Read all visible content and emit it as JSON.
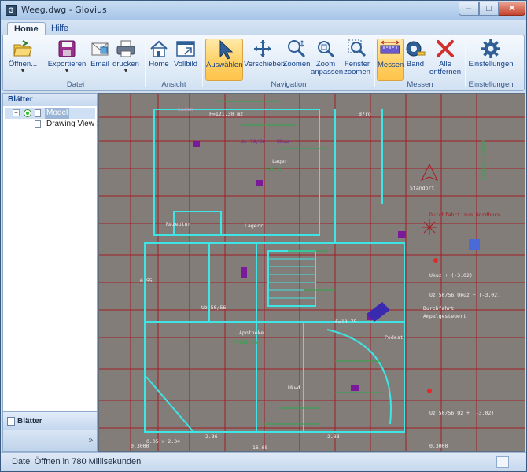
{
  "window": {
    "title": "Weeg.dwg - Glovius"
  },
  "tabs": [
    {
      "label": "Home"
    },
    {
      "label": "Hilfe"
    }
  ],
  "ribbon": {
    "datei": {
      "label": "Datei",
      "oeffnen": "Öffnen...",
      "exportieren": "Exportieren",
      "email": "Email",
      "drucken": "drucken"
    },
    "ansicht": {
      "label": "Ansicht",
      "home": "Home",
      "vollbild": "Vollbild"
    },
    "navigation": {
      "label": "Navigation",
      "auswaehlen": "Auswählen",
      "verschieben": "Verschieben",
      "zoomen": "Zoomen",
      "zoom_anpassen_1": "Zoom",
      "zoom_anpassen_2": "anpassen",
      "fenster_1": "Fenster",
      "fenster_2": "zoomen"
    },
    "messen": {
      "label": "Messen",
      "messen": "Messen",
      "band": "Band",
      "alle_1": "Alle",
      "alle_2": "entfernen"
    },
    "einstellungen": {
      "label": "Einstellungen",
      "einstellungen": "Einstellungen"
    }
  },
  "sheets_panel": {
    "header": "Blätter",
    "tree": [
      {
        "label": "Model"
      },
      {
        "label": "Drawing View 1"
      }
    ],
    "bottom_button": "Blätter",
    "chevron": "»"
  },
  "drawing": {
    "texts": [
      "Laden",
      "F=121.30 m2",
      "B7ro",
      "Lager",
      "F=6.29",
      "Standort",
      "Rezeptur",
      "F=11.7",
      "Lagerr",
      "Durchfahrt zum Nordhorn",
      "Apotheke",
      "F=161.58",
      "Podest",
      "Durchfahrt",
      "Ampelgesteuert",
      "F=18.75",
      "Uz 70/56",
      "Ukuz",
      "Uz 50/56",
      "Ukuz + (-3.02)",
      "Uz 50/56  Ukuz + (-3.02)",
      "Uz 50/56  Uz + (-3.02)",
      "2.36",
      "2.38",
      "16.68",
      "0.3000",
      "0.3000",
      "Ukwd",
      "0.05 > 2.34",
      "6.55",
      "Einstellungen"
    ]
  },
  "status": {
    "text": "Datei Öffnen in 780 Millisekunden"
  },
  "colors": {
    "accent_selected": "#ffd36b",
    "canvas_bg": "#837d7a",
    "cad_cyan": "#3fe4e4",
    "cad_red": "#a21e24",
    "cad_green": "#2fa84a",
    "cad_purple": "#7a1a9a"
  }
}
